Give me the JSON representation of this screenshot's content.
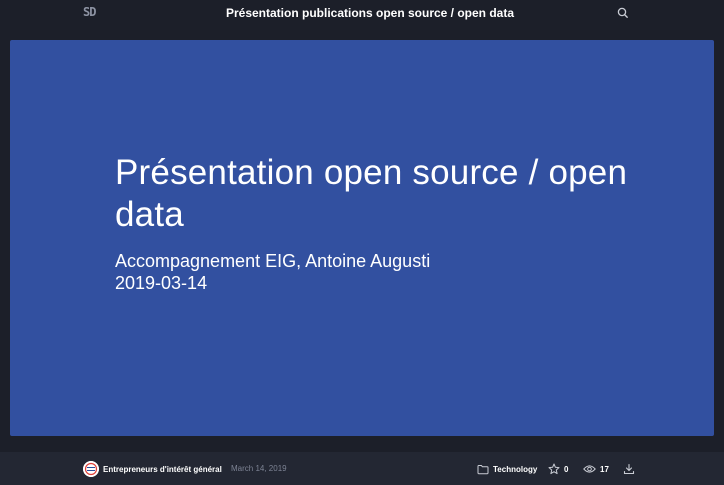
{
  "header": {
    "logo_text": "SD",
    "deck_title": "Présentation publications open source / open data"
  },
  "slide": {
    "title": "Présentation open source / open data",
    "subtitle_line1": "Accompagnement EIG, Antoine Augusti",
    "subtitle_line2": "2019-03-14",
    "background_color": "#3250a0"
  },
  "footer": {
    "author": "Entrepreneurs d'intérêt général",
    "date": "March 14, 2019",
    "category": "Technology",
    "stars": "0",
    "views": "17"
  },
  "icons": {
    "search": "search-icon",
    "folder": "folder-icon",
    "star": "star-icon",
    "eye": "eye-icon",
    "download": "download-icon"
  }
}
